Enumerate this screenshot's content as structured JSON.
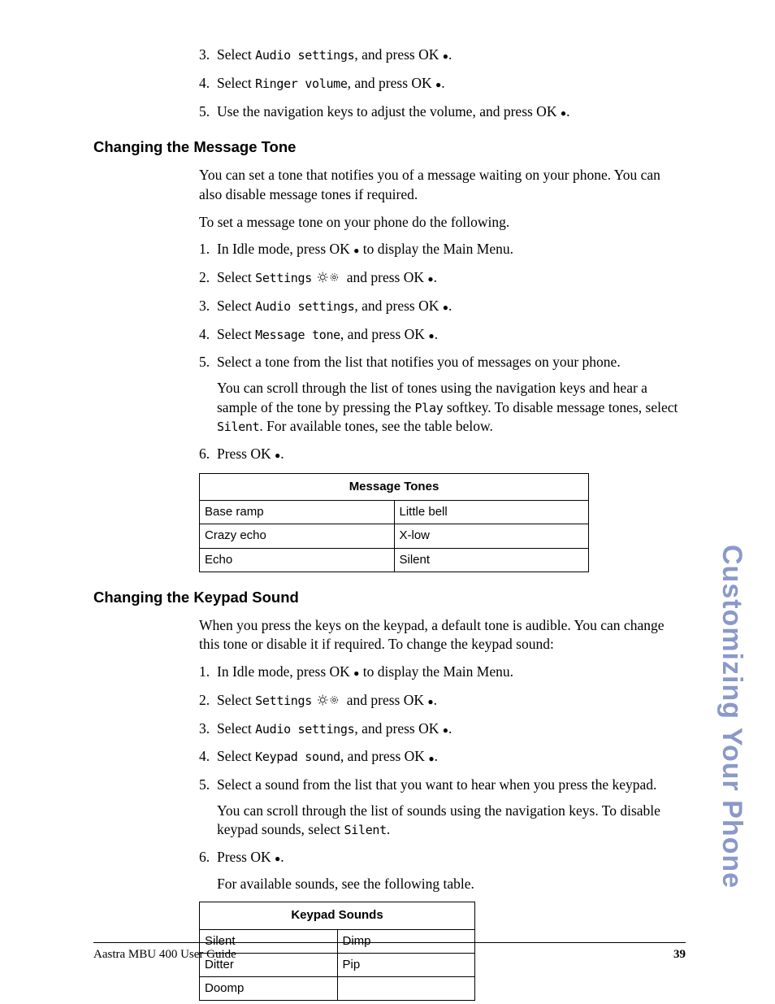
{
  "intro_steps": [
    {
      "n": "3.",
      "pre": "Select ",
      "mono": "Audio settings",
      "post": ", and press OK ",
      "bullet": true,
      "tail": "."
    },
    {
      "n": "4.",
      "pre": "Select ",
      "mono": "Ringer volume",
      "post": ", and press OK ",
      "bullet": true,
      "tail": "."
    },
    {
      "n": "5.",
      "pre": "Use the navigation keys to adjust the volume, and press OK ",
      "bullet": true,
      "tail": "."
    }
  ],
  "h_msg": "Changing the Message Tone",
  "msg_p1": "You can set a tone that notifies you of a message waiting on your phone. You can also disable message tones if required.",
  "msg_p2": "To set a message tone on your phone do the following.",
  "msg_steps": [
    {
      "n": "1.",
      "pre": "In Idle mode, press OK ",
      "bullet": true,
      "tail": " to display the Main Menu."
    },
    {
      "n": "2.",
      "pre": "Select ",
      "mono": "Settings",
      "gears": true,
      "post": " and press OK ",
      "bullet": true,
      "tail": "."
    },
    {
      "n": "3.",
      "pre": "Select ",
      "mono": "Audio settings",
      "post": ", and press OK ",
      "bullet": true,
      "tail": "."
    },
    {
      "n": "4.",
      "pre": "Select ",
      "mono": "Message tone",
      "post": ", and press OK ",
      "bullet": true,
      "tail": "."
    },
    {
      "n": "5.",
      "pre": "Select a tone from the list that notifies you of messages on your phone.",
      "sub": "You can scroll through the list of tones using the navigation keys and hear a sample of the tone by pressing the ",
      "mono_sub": "Play",
      "sub2": " softkey. To disable message tones, select ",
      "mono_sub2": "Silent",
      "sub3": ". For available tones, see the table below."
    },
    {
      "n": "6.",
      "pre": "Press OK ",
      "bullet": true,
      "tail": "."
    }
  ],
  "table_msg_header": "Message Tones",
  "chart_data": [
    {
      "type": "table",
      "title": "Message Tones",
      "columns": 2,
      "rows": [
        [
          "Base ramp",
          "Little bell"
        ],
        [
          "Crazy echo",
          "X-low"
        ],
        [
          "Echo",
          "Silent"
        ]
      ]
    },
    {
      "type": "table",
      "title": "Keypad Sounds",
      "columns": 2,
      "rows": [
        [
          "Silent",
          "Dimp"
        ],
        [
          "Ditter",
          "Pip"
        ],
        [
          "Doomp",
          ""
        ]
      ]
    }
  ],
  "h_key": "Changing the Keypad Sound",
  "key_p1": "When you press the keys on the keypad, a default tone is audible. You can change this tone or disable it if required. To change the keypad sound:",
  "key_steps": [
    {
      "n": "1.",
      "pre": "In Idle mode, press OK ",
      "bullet": true,
      "tail": " to display the Main Menu."
    },
    {
      "n": "2.",
      "pre": "Select ",
      "mono": "Settings",
      "gears": true,
      "post": " and press OK ",
      "bullet": true,
      "tail": "."
    },
    {
      "n": "3.",
      "pre": "Select ",
      "mono": "Audio settings",
      "post": ", and press OK ",
      "bullet": true,
      "tail": "."
    },
    {
      "n": "4.",
      "pre": "Select ",
      "mono": "Keypad sound",
      "post": ", and press OK ",
      "bullet": true,
      "tail": "."
    },
    {
      "n": "5.",
      "pre": "Select a sound from the list that you want to hear when you press the keypad.",
      "sub": "You can scroll through the list of sounds using the navigation keys. To disable keypad sounds, select ",
      "mono_sub": "Silent",
      "sub2": "."
    },
    {
      "n": "6.",
      "pre": "Press OK ",
      "bullet": true,
      "tail": ".",
      "sub": "For available sounds, see the following table."
    }
  ],
  "table_key_header": "Keypad Sounds",
  "side_tab": "Customizing Your Phone",
  "footer_left": "Aastra MBU 400 User Guide",
  "footer_right": "39"
}
